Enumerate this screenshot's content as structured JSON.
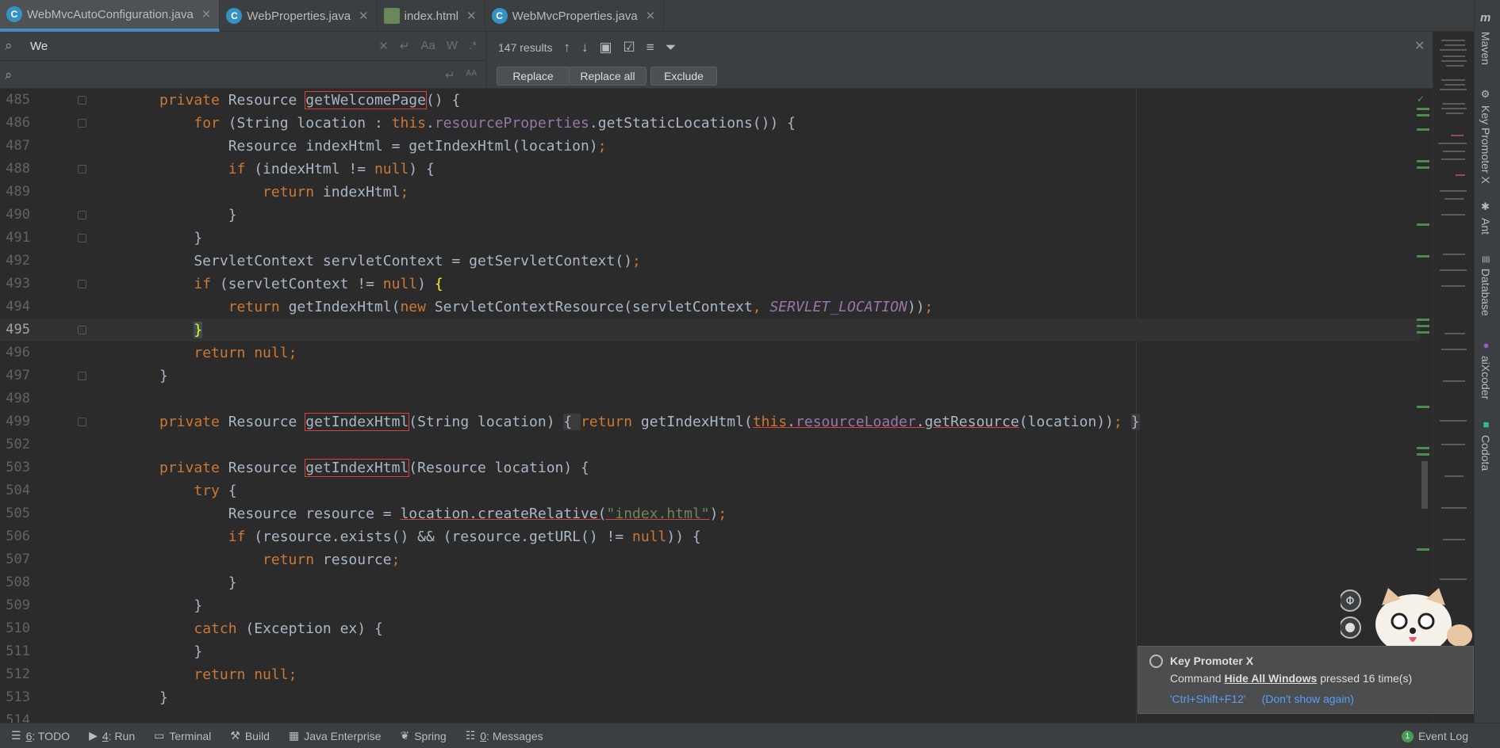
{
  "tabs": [
    {
      "label": "WebMvcAutoConfiguration.java",
      "icon": "java-class-icon",
      "active": true
    },
    {
      "label": "WebProperties.java",
      "icon": "java-class-icon",
      "active": false
    },
    {
      "label": "index.html",
      "icon": "html-file-icon",
      "active": false
    },
    {
      "label": "WebMvcProperties.java",
      "icon": "java-class-icon",
      "active": false
    }
  ],
  "search": {
    "find_value": "We",
    "replace_value": "",
    "results": "147 results",
    "buttons": {
      "replace": "Replace",
      "replace_all": "Replace all",
      "exclude": "Exclude"
    },
    "options": {
      "match_case": "Aa",
      "words": "W",
      "regex": ".*"
    }
  },
  "editor": {
    "current_line": "495",
    "line_numbers": [
      "485",
      "486",
      "487",
      "488",
      "489",
      "490",
      "491",
      "492",
      "493",
      "494",
      "495",
      "496",
      "497",
      "498",
      "499",
      "502",
      "503",
      "504",
      "505",
      "506",
      "507",
      "508",
      "509",
      "510",
      "511",
      "512",
      "513",
      "514"
    ]
  },
  "right_tools": [
    "Maven",
    "Key Promoter X",
    "Ant",
    "Database",
    "aiXcoder",
    "Codota"
  ],
  "notification": {
    "title": "Key Promoter X",
    "body_prefix": "Command",
    "command": "Hide All Windows",
    "body_suffix": "pressed 16 time(s)",
    "shortcut": "'Ctrl+Shift+F12'",
    "dont_show": "(Don't show again)"
  },
  "bottom_tools": [
    {
      "num": "6",
      "label": ": TODO",
      "icon": "todo-icon"
    },
    {
      "num": "4",
      "label": ": Run",
      "icon": "run-icon"
    },
    {
      "num": "",
      "label": "Terminal",
      "icon": "terminal-icon"
    },
    {
      "num": "",
      "label": "Build",
      "icon": "build-icon"
    },
    {
      "num": "",
      "label": "Java Enterprise",
      "icon": "java-enterprise-icon"
    },
    {
      "num": "",
      "label": "Spring",
      "icon": "spring-icon"
    },
    {
      "num": "0",
      "label": ": Messages",
      "icon": "messages-icon"
    }
  ],
  "event_log": "Event Log",
  "colors": {
    "accent": "#4a88c7",
    "keyword": "#cc7832",
    "field": "#9876aa",
    "string": "#6a8759",
    "text": "#a9b7c6",
    "match_border": "#e0403d"
  }
}
